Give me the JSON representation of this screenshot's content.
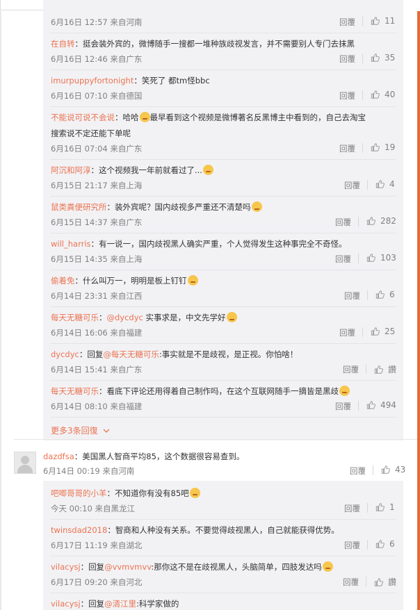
{
  "top_reply": {
    "time": "6月16日 12:57",
    "source": "来自河南",
    "reply": "回覆",
    "likes": "11"
  },
  "replies": [
    {
      "user": "在自转",
      "sep": "：",
      "text": "挺会装外宾的，微博随手一搜都一堆种族歧视发言，并不需要别人专门去抹黑",
      "time": "6月16日 12:46",
      "source": "来自广东",
      "reply": "回覆",
      "likes": "35"
    },
    {
      "user": "imurpuppyfortonight",
      "sep": "：",
      "text": "笑死了 都tm怪bbc",
      "time": "6月16日 07:10",
      "source": "来自德国",
      "reply": "回覆",
      "likes": "40"
    },
    {
      "user": "不能说可说不会说",
      "sep": "：",
      "text_a": "哈哈",
      "text_b": "最早看到这个视频是微博著名反黑博主中看到的，自己去淘宝",
      "text_c": "搜索说不定还能下单呢",
      "time": "6月16日 07:04",
      "source": "来自广东",
      "reply": "回覆",
      "likes": "19"
    },
    {
      "user": "阿沉和阿淳",
      "sep": "：",
      "text": "这个视频我一年前就看过了...",
      "time": "6月15日 21:17",
      "source": "来自上海",
      "reply": "回覆",
      "likes": "4"
    },
    {
      "user": "鼠类粪便研究所",
      "sep": "：",
      "text": "装外宾呢？国内歧视多严重还不清楚吗",
      "time": "6月15日 14:37",
      "source": "来自广东",
      "reply": "回覆",
      "likes": "282"
    },
    {
      "user": "will_harris",
      "sep": "：",
      "text": "有一说一，国内歧视黑人确实严重，个人觉得发生这种事完全不奇怪。",
      "time": "6月15日 14:35",
      "source": "来自上海",
      "reply": "回覆",
      "likes": "103"
    },
    {
      "user": "偷着免",
      "sep": "：",
      "text": "什么叫万一，明明是板上钉钉",
      "time": "6月14日 23:31",
      "source": "来自江西",
      "reply": "回覆",
      "likes": "6"
    },
    {
      "user": "每天无糖可乐",
      "sep": "：",
      "mention": "@dycdyc",
      "text": " 实事求是，中文先学好",
      "time": "6月14日 16:06",
      "source": "来自福建",
      "reply": "回覆",
      "likes": "25"
    },
    {
      "user": "dycdyc",
      "sep": "：",
      "prefix": "回复",
      "mention": "@每天无糖可乐",
      "text": ":事实就是不是歧视，是正视。你怕啥！",
      "time": "6月14日 15:41",
      "source": "来自广东",
      "reply": "回覆",
      "likes": "讚"
    },
    {
      "user": "每天无糖可乐",
      "sep": "：",
      "text": "看底下评论还用得着自己制作吗，在这个互联网随手一摘皆是黑歧",
      "time": "6月14日 08:10",
      "source": "来自福建",
      "reply": "回覆",
      "likes": "494"
    }
  ],
  "more": {
    "label": "更多3条回復",
    "icon": "chevron-down-icon"
  },
  "root": {
    "user": "dazdfsa",
    "sep": "：",
    "text": "美国黑人智商平均85，这个数据很容易查到。",
    "time": "6月14日 00:19",
    "source": "来自河南",
    "reply": "回覆",
    "likes": "43"
  },
  "replies2": [
    {
      "user": "吧唧哥哥的小羊",
      "sep": "：",
      "text": "不知道你有没有85吧",
      "time": "今天 00:10",
      "source": "来自黑龙江",
      "reply": "回覆",
      "likes": "1"
    },
    {
      "user": "twinsdad2018",
      "sep": "：",
      "text": "智商和人种没有关系。不要觉得歧视黑人，自己就能获得优势。",
      "time": "6月17日 11:19",
      "source": "来自湖北",
      "reply": "回覆",
      "likes": "6"
    },
    {
      "user": "vilacysj",
      "sep": "：",
      "prefix": "回复",
      "mention": "@vvmvmvv",
      "text": ":那你这不是在歧视黑人，头脑简单，四肢发达吗",
      "time": "6月17日 09:20",
      "source": "来自河北",
      "reply": "回覆",
      "likes": "讚"
    },
    {
      "user": "vilacysj",
      "sep": "：",
      "prefix": "回复",
      "mention": "@清江里",
      "text": ":科学家做的"
    }
  ],
  "colors": {
    "accent": "#eb7350",
    "panel": "#f2f2f5",
    "meta": "#808080"
  }
}
